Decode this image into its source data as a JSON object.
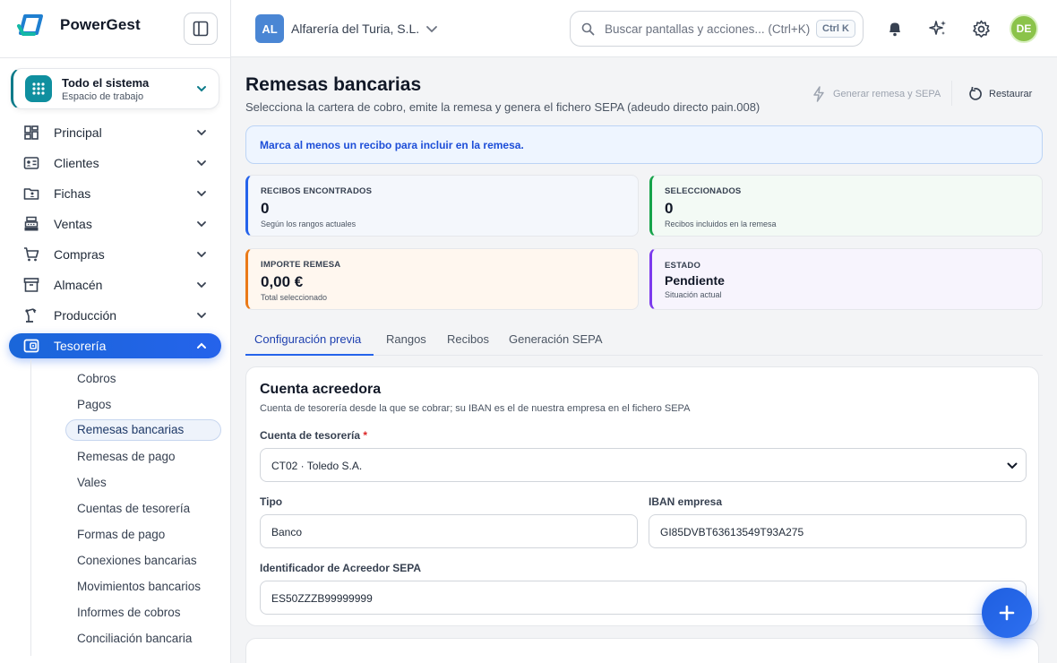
{
  "brand": {
    "name": "PowerGest"
  },
  "workspace": {
    "title": "Todo el sistema",
    "subtitle": "Espacio de trabajo"
  },
  "nav": {
    "items": [
      {
        "label": "Principal",
        "icon": "dashboard-icon"
      },
      {
        "label": "Clientes",
        "icon": "id-card-icon"
      },
      {
        "label": "Fichas",
        "icon": "folder-user-icon"
      },
      {
        "label": "Ventas",
        "icon": "cash-register-icon"
      },
      {
        "label": "Compras",
        "icon": "cart-icon"
      },
      {
        "label": "Almacén",
        "icon": "archive-icon"
      },
      {
        "label": "Producción",
        "icon": "robot-arm-icon"
      },
      {
        "label": "Tesorería",
        "icon": "wallet-icon",
        "active": true
      }
    ],
    "sub_items": [
      "Cobros",
      "Pagos",
      "Remesas bancarias",
      "Remesas de pago",
      "Vales",
      "Cuentas de tesorería",
      "Formas de pago",
      "Conexiones bancarias",
      "Movimientos bancarios",
      "Informes de cobros",
      "Conciliación bancaria"
    ],
    "active_sub": "Remesas bancarias"
  },
  "topbar": {
    "company_initials": "AL",
    "company_name": "Alfarería del Turia, S.L.",
    "search_placeholder": "Buscar pantallas y acciones... (Ctrl+K)",
    "search_shortcut": "Ctrl K",
    "avatar_initials": "DE"
  },
  "page": {
    "title": "Remesas bancarias",
    "subtitle": "Selecciona la cartera de cobro, emite la remesa y genera el fichero SEPA (adeudo directo pain.008)",
    "generate_button": "Generar remesa y SEPA",
    "restore_button": "Restaurar",
    "alert": "Marca al menos un recibo para incluir en la remesa."
  },
  "stats": {
    "recibos": {
      "label": "RECIBOS ENCONTRADOS",
      "value": "0",
      "sub": "Según los rangos actuales"
    },
    "seleccionados": {
      "label": "SELECCIONADOS",
      "value": "0",
      "sub": "Recibos incluidos en la remesa"
    },
    "importe": {
      "label": "IMPORTE REMESA",
      "value": "0,00 €",
      "sub": "Total seleccionado"
    },
    "estado": {
      "label": "ESTADO",
      "value": "Pendiente",
      "sub": "Situación actual"
    }
  },
  "tabs": [
    "Configuración previa",
    "Rangos",
    "Recibos",
    "Generación SEPA"
  ],
  "form": {
    "title": "Cuenta acreedora",
    "subtitle": "Cuenta de tesorería desde la que se cobrar; su IBAN es el de nuestra empresa en el fichero SEPA",
    "cuenta_label": "Cuenta de tesorería",
    "cuenta_required": "*",
    "cuenta_value": "CT02 · Toledo S.A.",
    "tipo_label": "Tipo",
    "tipo_value": "Banco",
    "iban_label": "IBAN empresa",
    "iban_value": "GI85DVBT63613549T93A275",
    "sepa_label": "Identificador de Acreedor SEPA",
    "sepa_value": "ES50ZZZB99999999"
  },
  "colors": {
    "accent": "#2563eb",
    "brand": "#0f8f9f",
    "success": "#16a34a",
    "warning": "#ea7a18",
    "purple": "#7c3aed"
  }
}
